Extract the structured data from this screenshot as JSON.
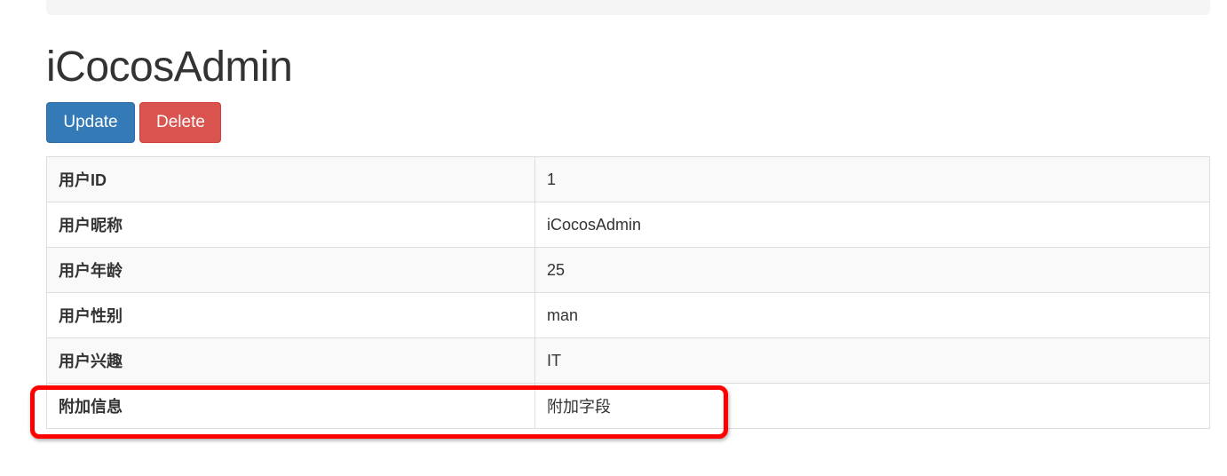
{
  "page": {
    "title": "iCocosAdmin"
  },
  "actions": {
    "update_label": "Update",
    "delete_label": "Delete"
  },
  "detail": {
    "rows": [
      {
        "label": "用户ID",
        "value": "1"
      },
      {
        "label": "用户昵称",
        "value": "iCocosAdmin"
      },
      {
        "label": "用户年龄",
        "value": "25"
      },
      {
        "label": "用户性别",
        "value": "man"
      },
      {
        "label": "用户兴趣",
        "value": "IT"
      },
      {
        "label": "附加信息",
        "value": "附加字段"
      }
    ]
  },
  "colors": {
    "primary": "#337ab7",
    "danger": "#d9534f",
    "highlight": "#ff0000"
  }
}
